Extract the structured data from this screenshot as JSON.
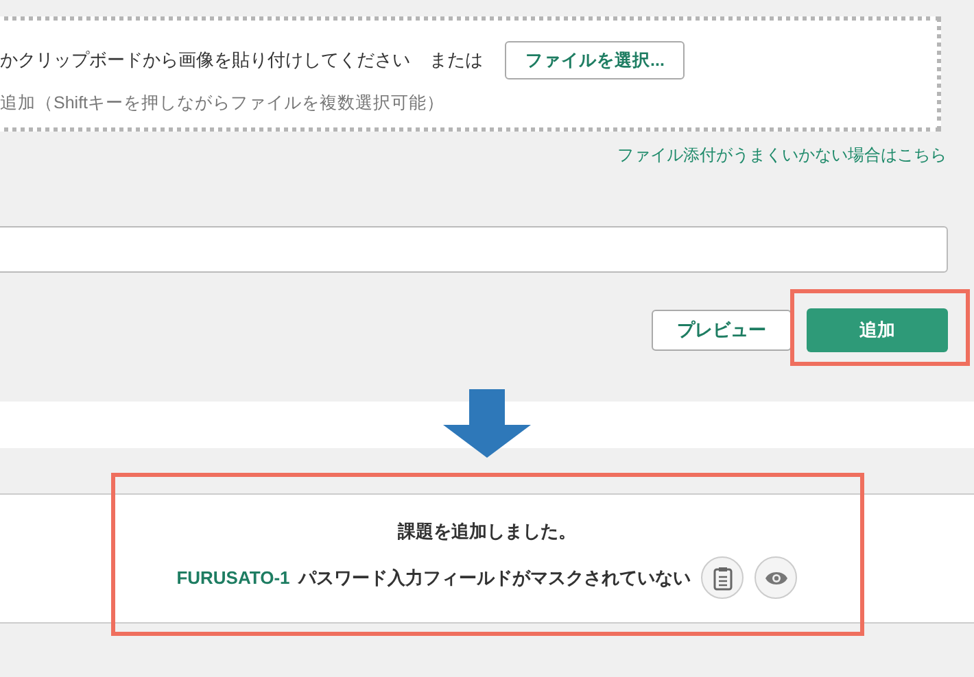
{
  "dropzone": {
    "instruction": "かクリップボードから画像を貼り付けしてください",
    "or_label": "または",
    "select_button": "ファイルを選択...",
    "hint": "追加（Shiftキーを押しながらファイルを複数選択可能）"
  },
  "help_link": "ファイル添付がうまくいかない場合はこちら",
  "buttons": {
    "preview": "プレビュー",
    "add": "追加"
  },
  "notification": {
    "message": "課題を追加しました。",
    "issue_key": "FURUSATO-1",
    "issue_title": "パスワード入力フィールドがマスクされていない"
  }
}
